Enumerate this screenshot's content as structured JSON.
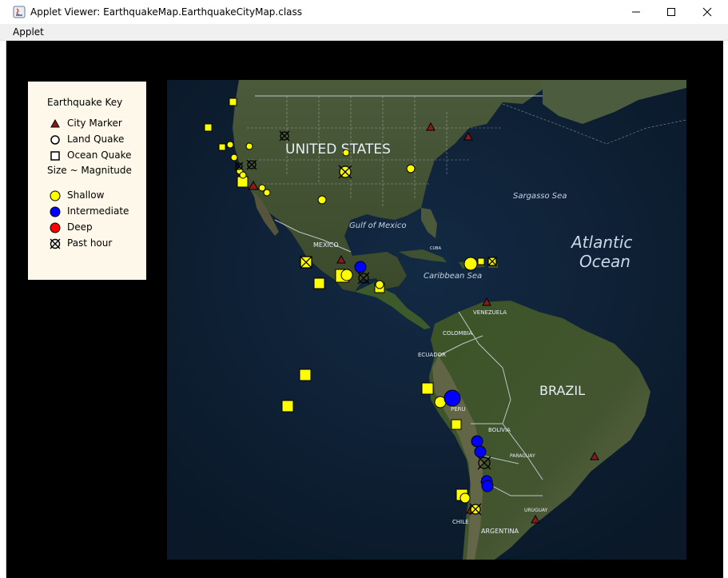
{
  "window": {
    "title": "Applet Viewer: EarthquakeMap.EarthquakeCityMap.class",
    "minimize_icon": "minimize-icon",
    "maximize_icon": "maximize-icon",
    "close_icon": "close-icon"
  },
  "menu": {
    "applet_label": "Applet"
  },
  "key": {
    "title": "Earthquake Key",
    "city_marker": "City Marker",
    "land_quake": "Land Quake",
    "ocean_quake": "Ocean Quake",
    "size_label": "Size ~ Magnitude",
    "shallow": "Shallow",
    "intermediate": "Intermediate",
    "deep": "Deep",
    "past_hour": "Past hour"
  },
  "map_labels": {
    "united_states": "UNITED STATES",
    "mexico": "MEXICO",
    "gulf_of_mexico": "Gulf of Mexico",
    "sargasso_sea": "Sargasso Sea",
    "atlantic_line1": "Atlantic",
    "atlantic_line2": "Ocean",
    "caribbean_sea": "Caribbean Sea",
    "cuba": "CUBA",
    "venezuela": "VENEZUELA",
    "colombia": "COLOMBIA",
    "ecuador": "ECUADOR",
    "peru": "PERU",
    "brazil": "BRAZIL",
    "bolivia": "BOLIVIA",
    "paraguay": "PARAGUAY",
    "uruguay": "URUGUAY",
    "chile": "CHILE",
    "argentina": "ARGENTINA"
  },
  "colors": {
    "shallow": "#ffff00",
    "intermediate": "#0000ff",
    "deep": "#ff0000",
    "city": "#8b1a1a",
    "ocean": "#0b1c30",
    "land": "#3b4a2c",
    "key_bg": "#fdf8ea"
  }
}
